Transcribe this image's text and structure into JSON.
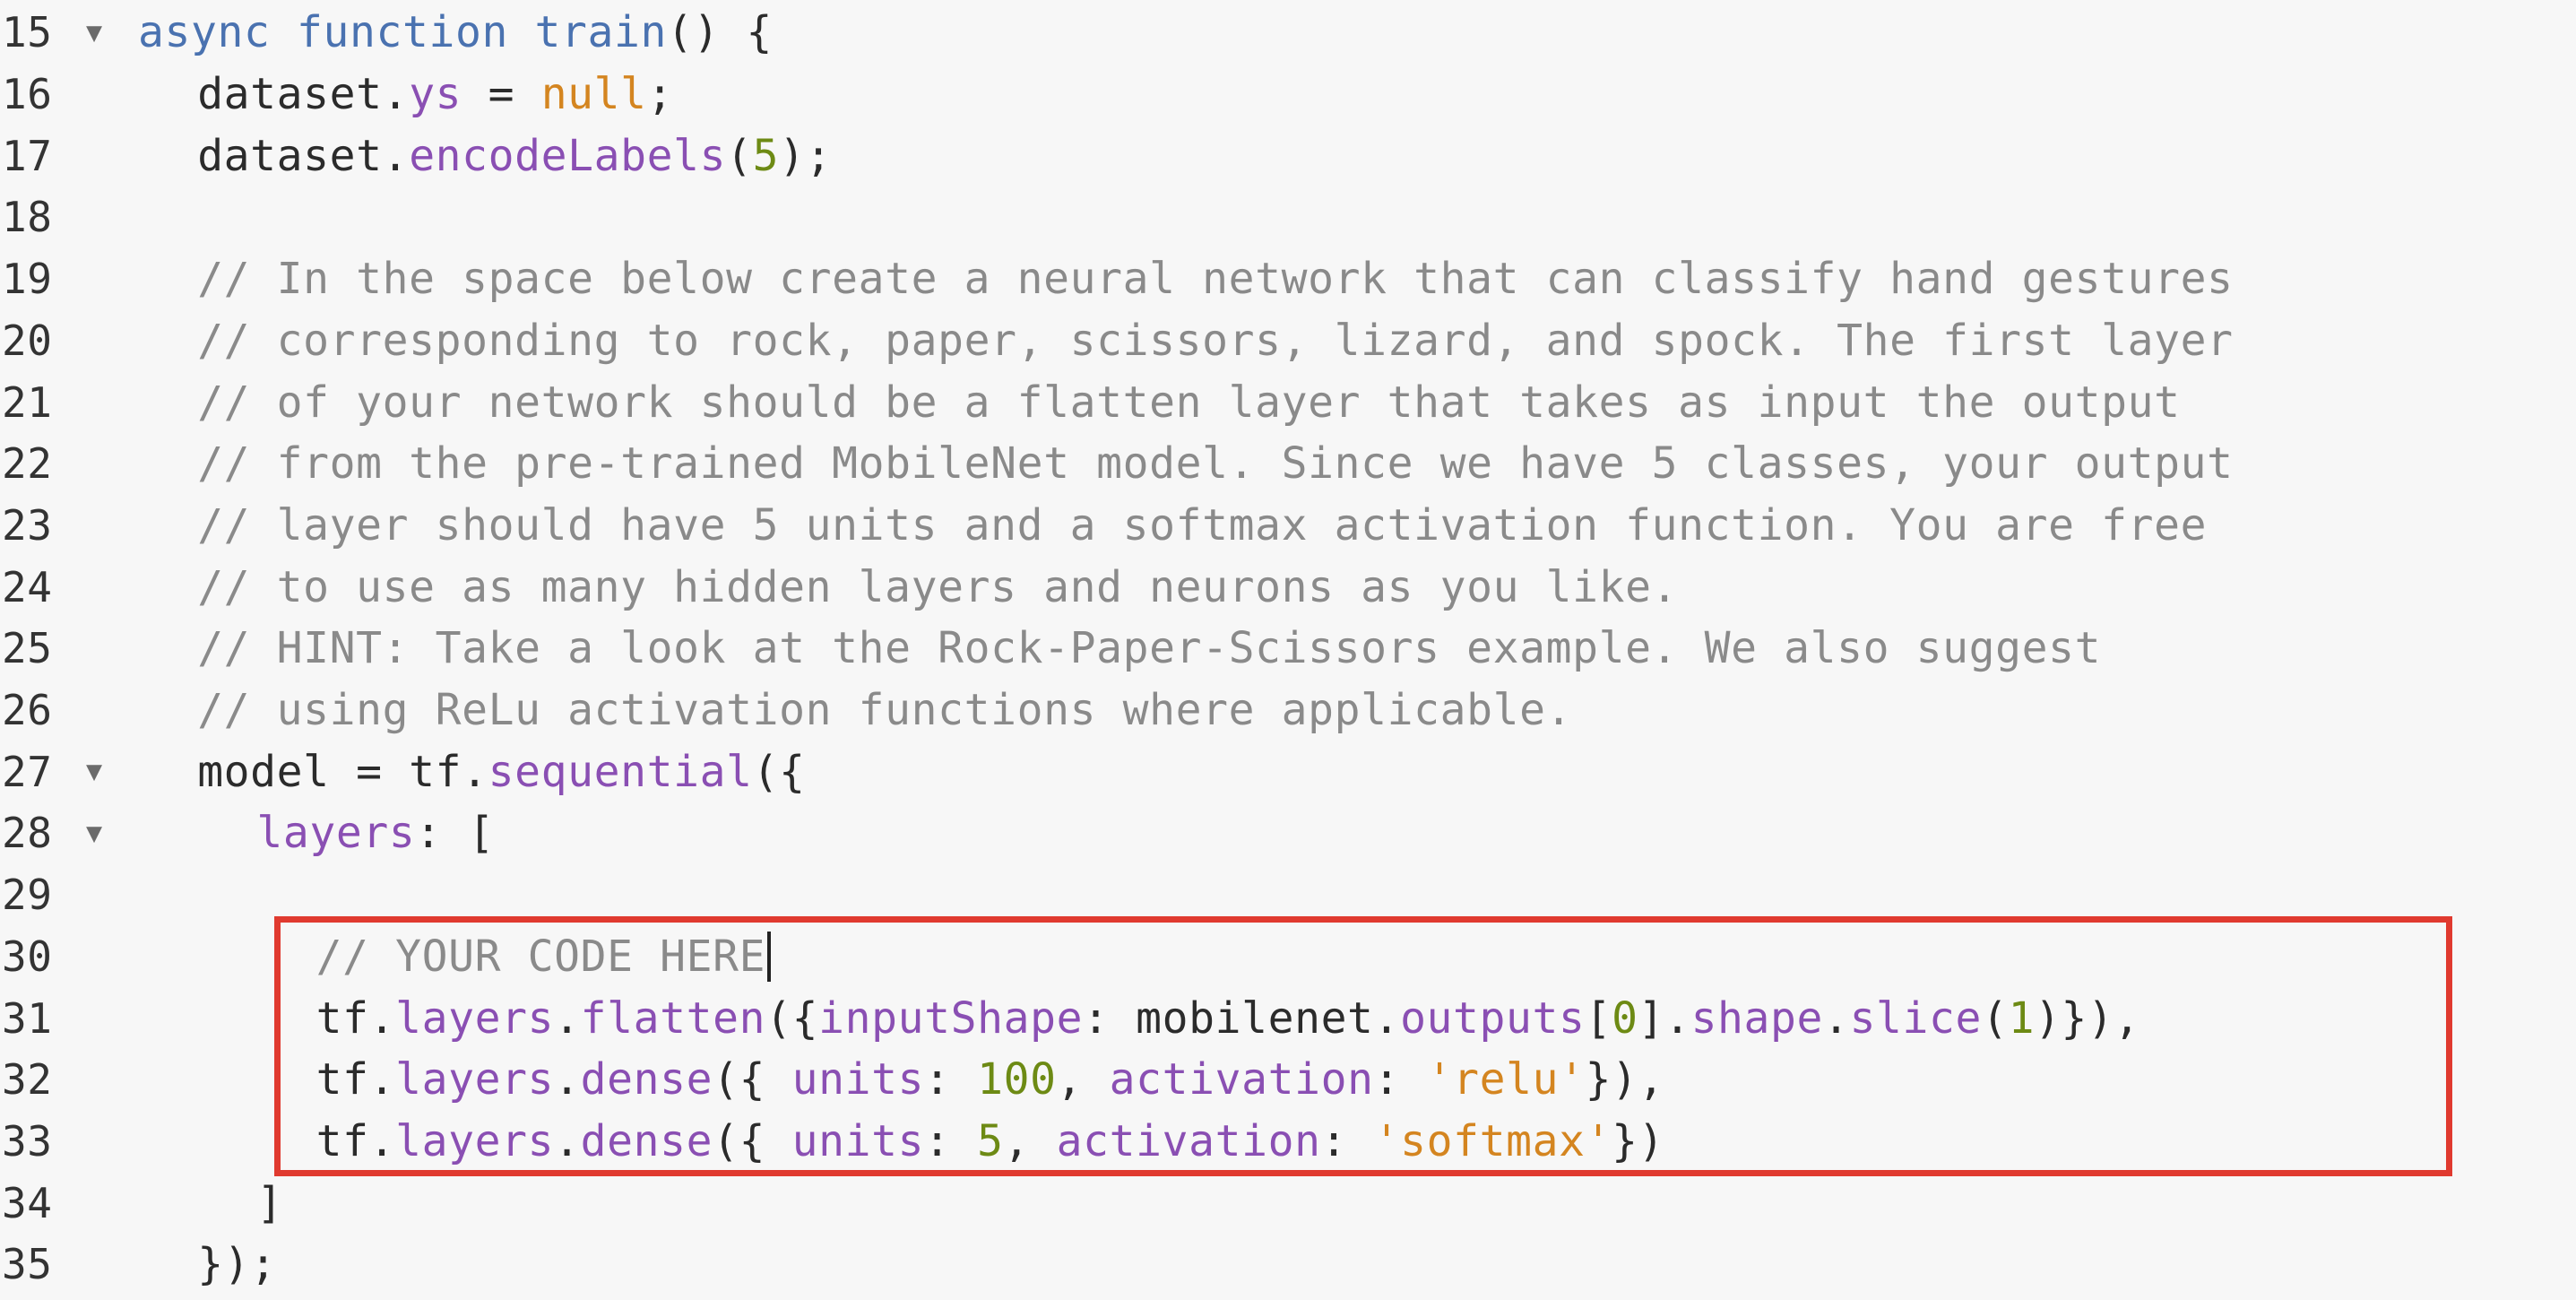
{
  "editor": {
    "lines": [
      {
        "num": "15",
        "fold": true,
        "indent": 0,
        "tokens": [
          [
            "kw",
            "async "
          ],
          [
            "kw",
            "function "
          ],
          [
            "kw",
            "train"
          ],
          [
            "plain",
            "() {"
          ]
        ]
      },
      {
        "num": "16",
        "fold": false,
        "indent": 2,
        "tokens": [
          [
            "plain",
            "dataset."
          ],
          [
            "prop",
            "ys"
          ],
          [
            "plain",
            " = "
          ],
          [
            "null",
            "null"
          ],
          [
            "plain",
            ";"
          ]
        ]
      },
      {
        "num": "17",
        "fold": false,
        "indent": 2,
        "tokens": [
          [
            "plain",
            "dataset."
          ],
          [
            "prop",
            "encodeLabels"
          ],
          [
            "plain",
            "("
          ],
          [
            "num",
            "5"
          ],
          [
            "plain",
            ");"
          ]
        ]
      },
      {
        "num": "18",
        "fold": false,
        "indent": 0,
        "tokens": []
      },
      {
        "num": "19",
        "fold": false,
        "indent": 2,
        "tokens": [
          [
            "cmt",
            "// In the space below create a neural network that can classify hand gestures"
          ]
        ]
      },
      {
        "num": "20",
        "fold": false,
        "indent": 2,
        "tokens": [
          [
            "cmt",
            "// corresponding to rock, paper, scissors, lizard, and spock. The first layer"
          ]
        ]
      },
      {
        "num": "21",
        "fold": false,
        "indent": 2,
        "tokens": [
          [
            "cmt",
            "// of your network should be a flatten layer that takes as input the output"
          ]
        ]
      },
      {
        "num": "22",
        "fold": false,
        "indent": 2,
        "tokens": [
          [
            "cmt",
            "// from the pre-trained MobileNet model. Since we have 5 classes, your output"
          ]
        ]
      },
      {
        "num": "23",
        "fold": false,
        "indent": 2,
        "tokens": [
          [
            "cmt",
            "// layer should have 5 units and a softmax activation function. You are free"
          ]
        ]
      },
      {
        "num": "24",
        "fold": false,
        "indent": 2,
        "tokens": [
          [
            "cmt",
            "// to use as many hidden layers and neurons as you like."
          ]
        ]
      },
      {
        "num": "25",
        "fold": false,
        "indent": 2,
        "tokens": [
          [
            "cmt",
            "// HINT: Take a look at the Rock-Paper-Scissors example. We also suggest"
          ]
        ]
      },
      {
        "num": "26",
        "fold": false,
        "indent": 2,
        "tokens": [
          [
            "cmt",
            "// using ReLu activation functions where applicable."
          ]
        ]
      },
      {
        "num": "27",
        "fold": true,
        "indent": 2,
        "tokens": [
          [
            "plain",
            "model = tf."
          ],
          [
            "prop",
            "sequential"
          ],
          [
            "plain",
            "({"
          ]
        ]
      },
      {
        "num": "28",
        "fold": true,
        "indent": 4,
        "tokens": [
          [
            "prop",
            "layers"
          ],
          [
            "plain",
            ": ["
          ]
        ]
      },
      {
        "num": "29",
        "fold": false,
        "indent": 0,
        "tokens": []
      },
      {
        "num": "30",
        "fold": false,
        "indent": 6,
        "tokens": [
          [
            "cmt",
            "// YOUR CODE HERE"
          ]
        ],
        "cursor": true
      },
      {
        "num": "31",
        "fold": false,
        "indent": 6,
        "tokens": [
          [
            "plain",
            "tf."
          ],
          [
            "prop",
            "layers"
          ],
          [
            "plain",
            "."
          ],
          [
            "prop",
            "flatten"
          ],
          [
            "plain",
            "({"
          ],
          [
            "prop",
            "inputShape"
          ],
          [
            "plain",
            ": mobilenet."
          ],
          [
            "prop",
            "outputs"
          ],
          [
            "plain",
            "["
          ],
          [
            "num",
            "0"
          ],
          [
            "plain",
            "]."
          ],
          [
            "prop",
            "shape"
          ],
          [
            "plain",
            "."
          ],
          [
            "prop",
            "slice"
          ],
          [
            "plain",
            "("
          ],
          [
            "num",
            "1"
          ],
          [
            "plain",
            ")}),"
          ]
        ]
      },
      {
        "num": "32",
        "fold": false,
        "indent": 6,
        "tokens": [
          [
            "plain",
            "tf."
          ],
          [
            "prop",
            "layers"
          ],
          [
            "plain",
            "."
          ],
          [
            "prop",
            "dense"
          ],
          [
            "plain",
            "({ "
          ],
          [
            "prop",
            "units"
          ],
          [
            "plain",
            ": "
          ],
          [
            "num",
            "100"
          ],
          [
            "plain",
            ", "
          ],
          [
            "prop",
            "activation"
          ],
          [
            "plain",
            ": "
          ],
          [
            "str",
            "'relu'"
          ],
          [
            "plain",
            "}),"
          ]
        ]
      },
      {
        "num": "33",
        "fold": false,
        "indent": 6,
        "tokens": [
          [
            "plain",
            "tf."
          ],
          [
            "prop",
            "layers"
          ],
          [
            "plain",
            "."
          ],
          [
            "prop",
            "dense"
          ],
          [
            "plain",
            "({ "
          ],
          [
            "prop",
            "units"
          ],
          [
            "plain",
            ": "
          ],
          [
            "num",
            "5"
          ],
          [
            "plain",
            ", "
          ],
          [
            "prop",
            "activation"
          ],
          [
            "plain",
            ": "
          ],
          [
            "str",
            "'softmax'"
          ],
          [
            "plain",
            "})"
          ]
        ]
      },
      {
        "num": "34",
        "fold": false,
        "indent": 4,
        "tokens": [
          [
            "plain",
            "]"
          ]
        ]
      },
      {
        "num": "35",
        "fold": false,
        "indent": 2,
        "tokens": [
          [
            "plain",
            "});"
          ]
        ]
      }
    ],
    "fold_glyph": "▼"
  },
  "annotation": {
    "box_color": "#e03a2f"
  },
  "colors": {
    "background": "#f7f7f7",
    "keyword": "#4a72b0",
    "property": "#8a4fb3",
    "number": "#6d8a14",
    "string": "#d48520",
    "comment": "#8a8a8a",
    "text": "#2b2b2b"
  }
}
